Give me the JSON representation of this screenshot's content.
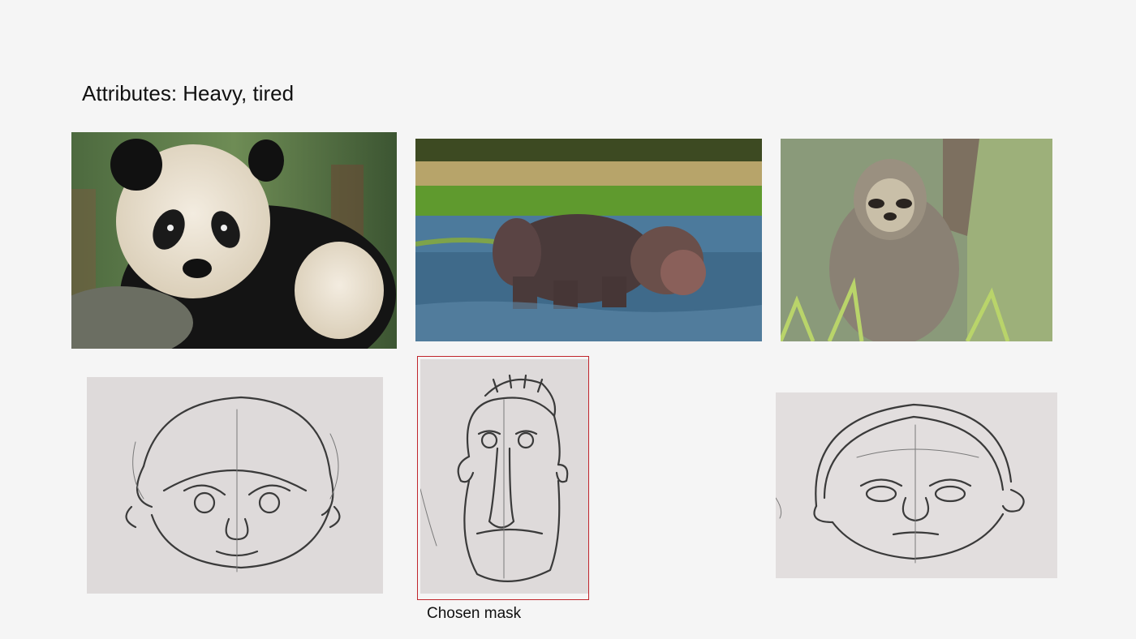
{
  "slide": {
    "title": "Attributes: Heavy, tired",
    "caption": "Chosen mask"
  },
  "photos": [
    {
      "subject": "giant panda",
      "icon": "panda-photo"
    },
    {
      "subject": "hippopotamuses in water",
      "icon": "hippo-photo"
    },
    {
      "subject": "three-toed sloth on tree",
      "icon": "sloth-photo"
    }
  ],
  "sketches": [
    {
      "subject": "pencil sketch of heavy face",
      "selected": false
    },
    {
      "subject": "pencil sketch of long tired face",
      "selected": true
    },
    {
      "subject": "pencil sketch of wide tired face",
      "selected": false
    }
  ],
  "colors": {
    "background": "#f5f5f5",
    "selection_border": "#c0262c",
    "paper": "#dcd8d8"
  }
}
